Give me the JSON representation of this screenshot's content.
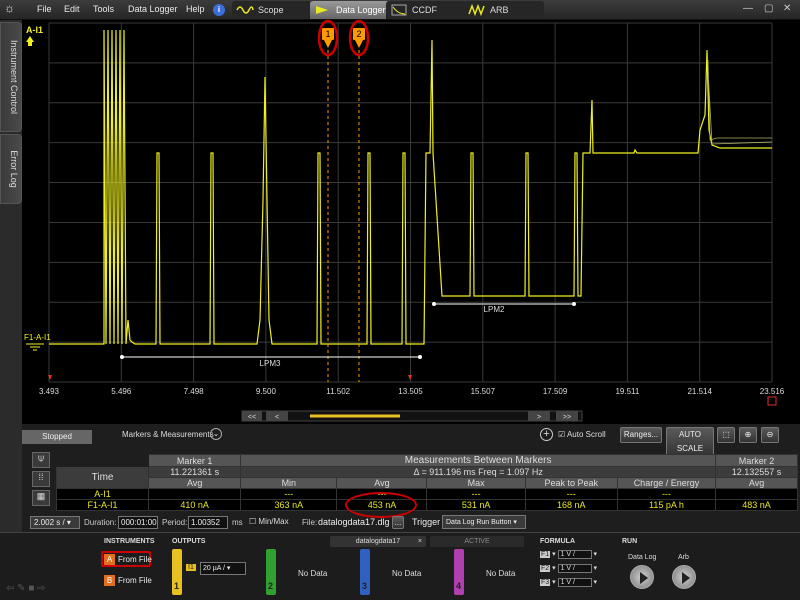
{
  "menu": {
    "file": "File",
    "edit": "Edit",
    "tools": "Tools",
    "data_logger": "Data Logger",
    "help": "Help"
  },
  "tabs": [
    {
      "label": "Scope"
    },
    {
      "label": "Data Logger"
    },
    {
      "label": "CCDF"
    },
    {
      "label": "ARB"
    }
  ],
  "side_tabs": {
    "instrument_control": "Instrument Control",
    "error_log": "Error Log"
  },
  "plot": {
    "channel_top_label": "A-I1",
    "channel_ref_label": "F1-A-I1",
    "marker1_label": "1",
    "marker2_label": "2",
    "x_ticks": [
      "3.493",
      "5.496",
      "7.498",
      "9.500",
      "11.502",
      "13.505",
      "15.507",
      "17.509",
      "19.511",
      "21.514",
      "23.516"
    ],
    "annotations": [
      "LPM3",
      "LPM2"
    ],
    "scroll_buttons": [
      "<<",
      "<",
      ">",
      ">>"
    ]
  },
  "panel": {
    "status": "Stopped",
    "markers_label": "Markers & Measurements",
    "auto_scroll": "Auto Scroll",
    "ranges": "Ranges...",
    "auto_scale": "AUTO SCALE",
    "table": {
      "marker1_header": "Marker 1",
      "marker2_header": "Marker 2",
      "between_header": "Measurements Between Markers",
      "time_label": "Time",
      "marker1_time": "11.221361 s",
      "marker2_time": "12.132557 s",
      "delta_line": "Δ = 911.196 ms   Freq = 1.097 Hz",
      "col_headers": [
        "Avg",
        "Min",
        "Avg",
        "Max",
        "Peak to Peak",
        "Charge / Energy",
        "Avg"
      ],
      "rows": [
        {
          "label": "A-I1",
          "values": [
            "",
            "---",
            "---",
            "---",
            "---",
            "---",
            ""
          ]
        },
        {
          "label": "F1-A-I1",
          "values": [
            "410 nA",
            "363 nA",
            "453 nA",
            "531 nA",
            "168 nA",
            "115 pA h",
            "483 nA"
          ]
        }
      ]
    },
    "time_per_div": "2.002 s /",
    "duration_label": "Duration:",
    "duration": "000:01:00",
    "period_label": "Period:",
    "period": "1.00352",
    "period_unit": "ms",
    "minmax": "Min/Max",
    "file_label": "File:",
    "file": "datalogdata17.dlg",
    "file_btn": "...",
    "trigger_label": "Trigger",
    "trigger_value": "Data Log Run Button"
  },
  "bottom": {
    "instruments_title": "INSTRUMENTS",
    "inst_a_letter": "A",
    "inst_a": "From File",
    "inst_b_letter": "B",
    "inst_b": "From File",
    "outputs_title": "OUTPUTS",
    "out1_num": "1",
    "out1_ch": "I1",
    "out1_scale": "20 µA /",
    "out2_num": "2",
    "out3_num": "3",
    "out4_num": "4",
    "no_data": "No Data",
    "file_tab": "datalogdata17",
    "file_tab_close": "×",
    "active_tab": "ACTIVE",
    "formula_title": "FORMULA",
    "formulas": [
      {
        "name": "F1",
        "scale": "1 V /"
      },
      {
        "name": "F2",
        "scale": "1 V /"
      },
      {
        "name": "F3",
        "scale": "1 V /"
      }
    ],
    "run_title": "RUN",
    "run_datalog": "Data Log",
    "run_arb": "Arb"
  },
  "colors": {
    "trace": "#f0f020",
    "marker": "#ff9900",
    "highlight": "#cc0000",
    "out1": "#e8c020",
    "out2": "#30a030",
    "out3": "#3060c0",
    "out4": "#b040b0"
  }
}
